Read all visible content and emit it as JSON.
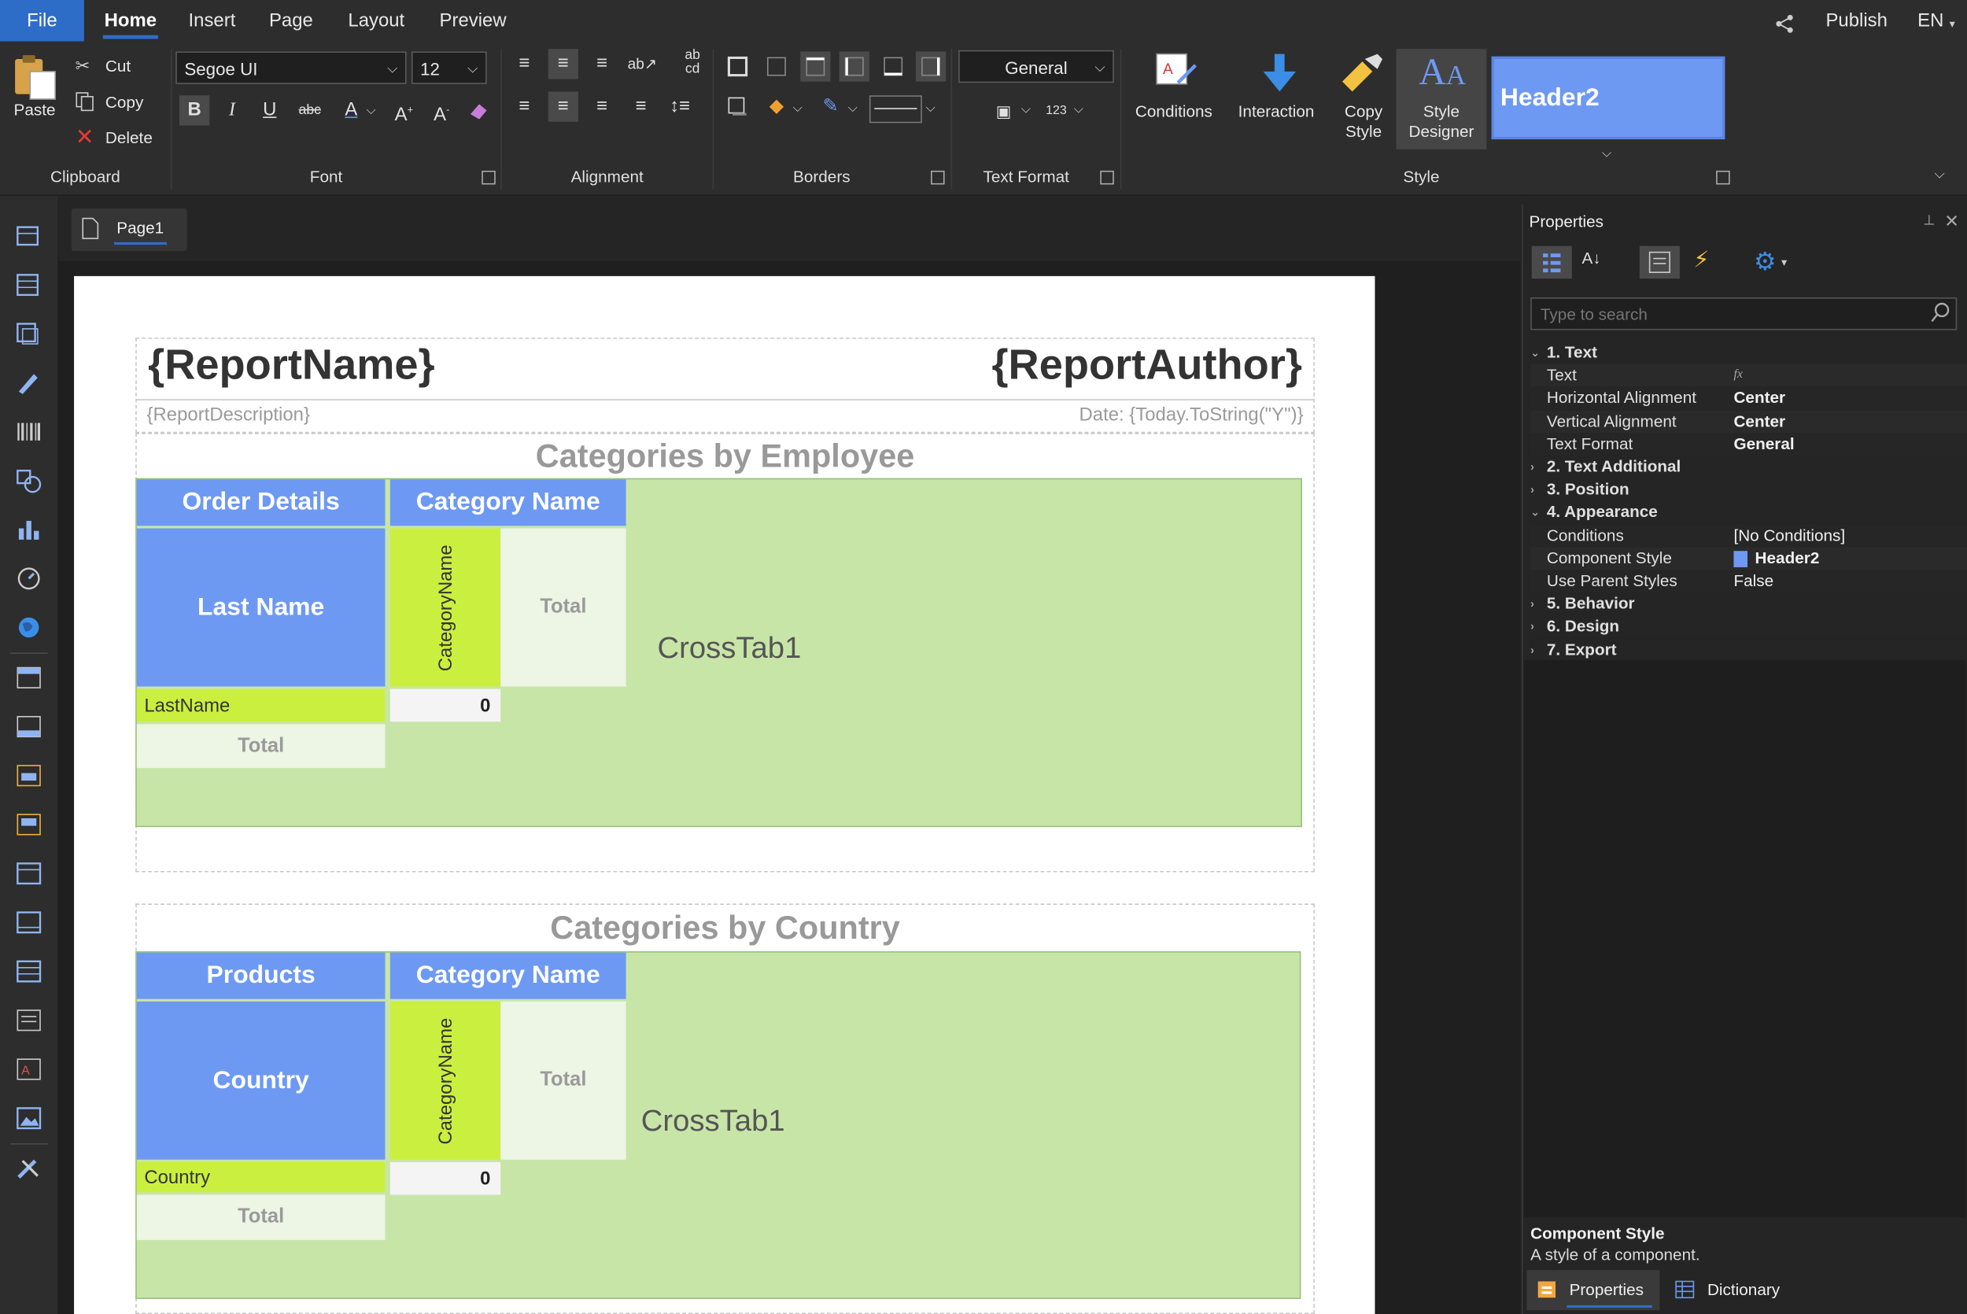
{
  "menubar": {
    "tabs": [
      "File",
      "Home",
      "Insert",
      "Page",
      "Layout",
      "Preview"
    ],
    "publish": "Publish",
    "language": "EN"
  },
  "ribbon": {
    "clipboard": {
      "paste": "Paste",
      "cut": "Cut",
      "copy": "Copy",
      "delete": "Delete",
      "label": "Clipboard"
    },
    "font": {
      "family": "Segoe UI",
      "size": "12",
      "label": "Font"
    },
    "alignment": {
      "label": "Alignment"
    },
    "borders": {
      "label": "Borders"
    },
    "text_format": {
      "value": "General",
      "label": "Text Format"
    },
    "style": {
      "conditions": "Conditions",
      "interaction": "Interaction",
      "copy_style": "Copy Style",
      "style_designer": "Style Designer",
      "preview_style": "Header2",
      "label": "Style"
    }
  },
  "document": {
    "page_tab": "Page1",
    "report_name": "{ReportName}",
    "report_author": "{ReportAuthor}",
    "report_description": "{ReportDescription}",
    "date": "Date: {Today.ToString(\"Y\")}",
    "crosstab1": {
      "title": "Categories by Employee",
      "row_header": "Order Details",
      "col_header": "Category Name",
      "row_field": "Last Name",
      "col_field": "CategoryName",
      "col_total": "Total",
      "row_value": "LastName",
      "cell_value": "0",
      "row_total": "Total",
      "name": "CrossTab1"
    },
    "crosstab2": {
      "title": "Categories by Country",
      "row_header": "Products",
      "col_header": "Category Name",
      "row_field": "Country",
      "col_field": "CategoryName",
      "col_total": "Total",
      "row_value": "Country",
      "cell_value": "0",
      "row_total": "Total",
      "name": "CrossTab1"
    }
  },
  "properties": {
    "title": "Properties",
    "search_placeholder": "Type to search",
    "rows": [
      {
        "name": "1. Text",
        "value": "",
        "category": true,
        "expanded": true
      },
      {
        "name": "Text",
        "value": "fx"
      },
      {
        "name": "Horizontal Alignment",
        "value": "Center",
        "bold": true
      },
      {
        "name": "Vertical Alignment",
        "value": "Center",
        "bold": true
      },
      {
        "name": "Text Format",
        "value": "General",
        "bold": true
      },
      {
        "name": "2. Text  Additional",
        "value": "",
        "category": true
      },
      {
        "name": "3. Position",
        "value": "",
        "category": true
      },
      {
        "name": "4. Appearance",
        "value": "",
        "category": true,
        "expanded": true
      },
      {
        "name": "Conditions",
        "value": "[No Conditions]"
      },
      {
        "name": "Component Style",
        "value": "Header2",
        "bold": true,
        "swatch": "#6e99f2"
      },
      {
        "name": "Use Parent Styles",
        "value": "False"
      },
      {
        "name": "5. Behavior",
        "value": "",
        "category": true
      },
      {
        "name": "6. Design",
        "value": "",
        "category": true
      },
      {
        "name": "7. Export",
        "value": "",
        "category": true
      }
    ],
    "description_title": "Component Style",
    "description_text": "A style of a component.",
    "bottom_tabs": {
      "properties": "Properties",
      "dictionary": "Dictionary"
    }
  },
  "colors": {
    "accent": "#2e6dc7",
    "header_blue": "#6e99f2",
    "lime": "#cbef3e",
    "crosstab_bg": "#c8e5a8"
  }
}
